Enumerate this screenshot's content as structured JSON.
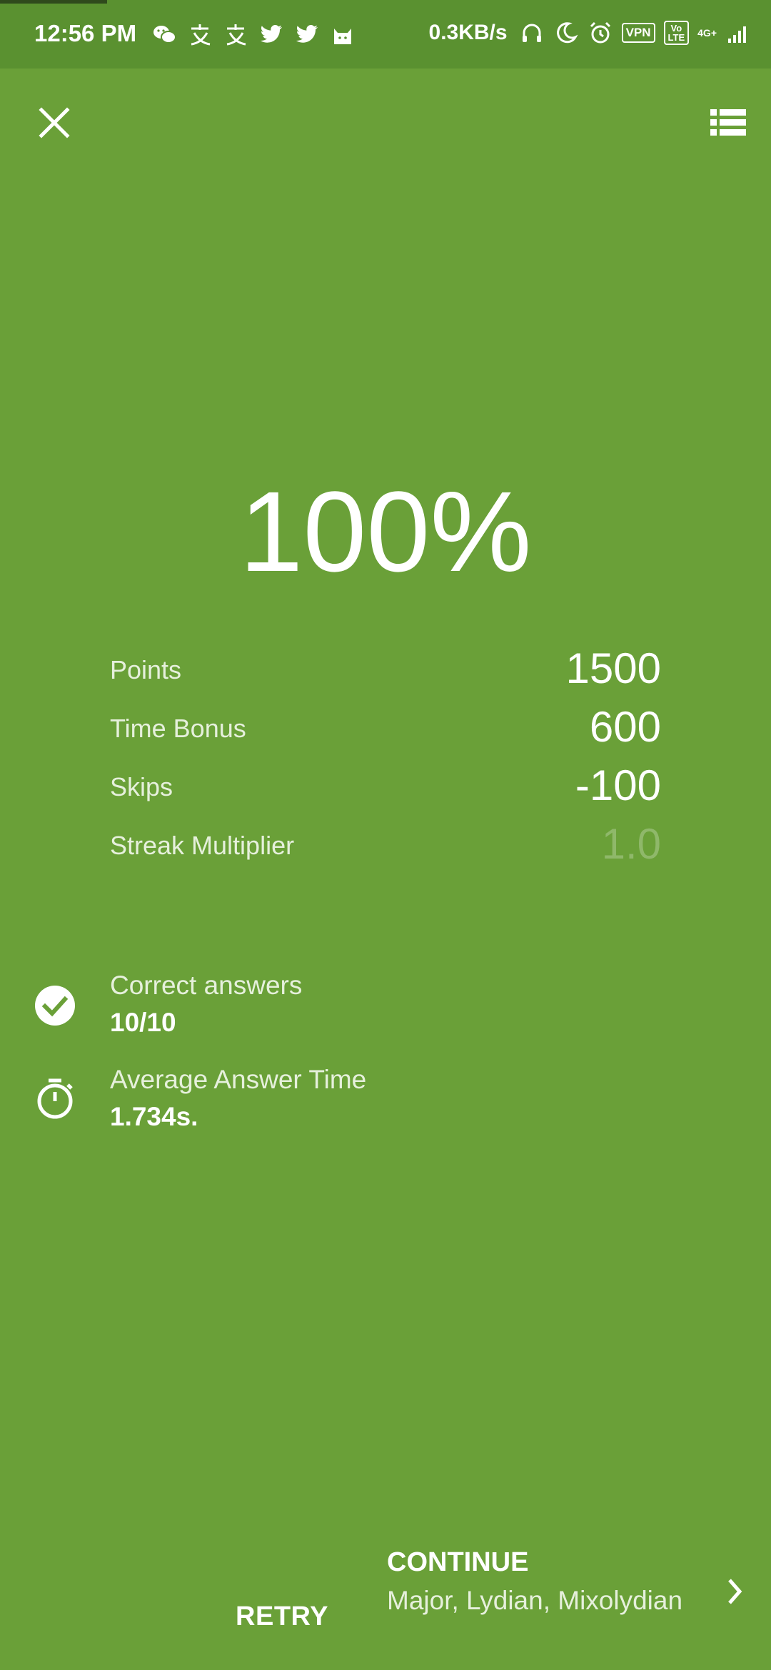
{
  "status_bar": {
    "time": "12:56 PM",
    "speed": "0.3KB/s",
    "vpn": "VPN",
    "volte_top": "Vo",
    "volte_bottom": "LTE",
    "network": "4G+",
    "left_icons": [
      "wechat-icon",
      "alipay-icon",
      "alipay-icon",
      "twitter-icon",
      "twitter-icon",
      "cat-icon"
    ],
    "right_icons": [
      "headphones-icon",
      "moon-icon",
      "alarm-icon",
      "vpn-icon",
      "volte-icon",
      "signal-icon"
    ]
  },
  "toolbar": {
    "close_icon": "close-icon",
    "list_icon": "list-icon"
  },
  "result": {
    "percentage": "100%"
  },
  "stats": [
    {
      "label": "Points",
      "value": "1500"
    },
    {
      "label": "Time Bonus",
      "value": "600"
    },
    {
      "label": "Skips",
      "value": "-100"
    },
    {
      "label": "Streak Multiplier",
      "value": "1.0"
    }
  ],
  "summary": {
    "correct": {
      "label": "Correct answers",
      "value": "10/10",
      "icon": "check-circle-icon"
    },
    "avg_time": {
      "label": "Average Answer Time",
      "value": "1.734s.",
      "icon": "stopwatch-icon"
    }
  },
  "actions": {
    "retry_label": "RETRY",
    "continue_label": "CONTINUE",
    "continue_subtitle": "Major, Lydian, Mixolydian"
  },
  "colors": {
    "background": "#6aa038",
    "status_bar": "#5a9130",
    "text": "#ffffff",
    "dim_text": "#8fb86a"
  }
}
